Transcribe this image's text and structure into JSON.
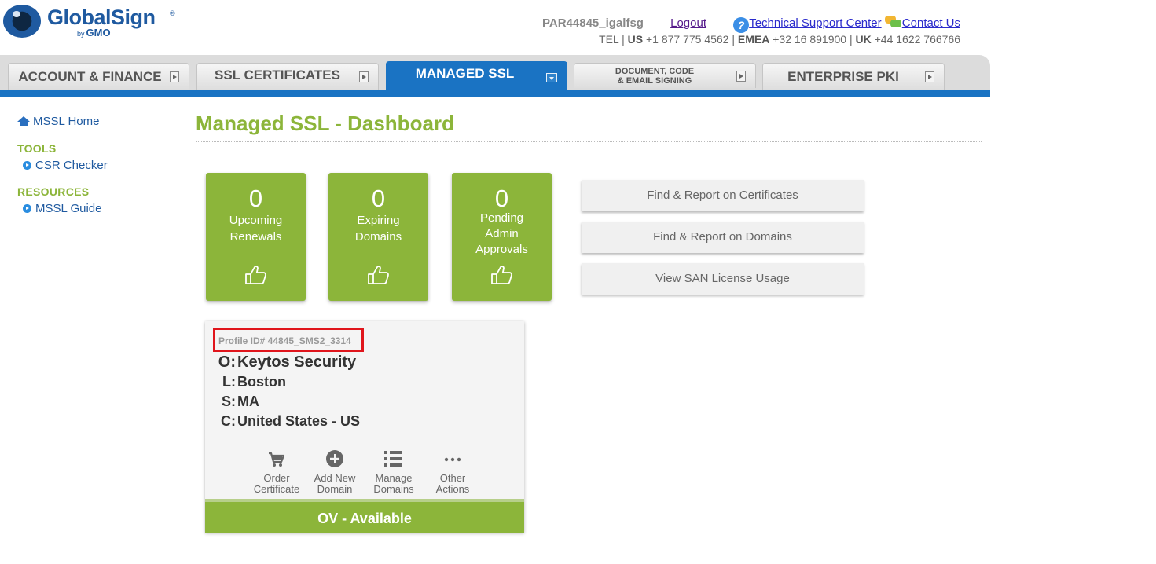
{
  "brand": {
    "name": "GlobalSign",
    "reg": "®",
    "by": "by",
    "gmo": "GMO"
  },
  "header": {
    "username": "PAR44845_igalfsg",
    "logout": "Logout",
    "support": "Technical Support Center",
    "contact": "Contact Us",
    "tel_label": "TEL",
    "us_label": "US",
    "us_phone": "+1 877 775 4562",
    "emea_label": "EMEA",
    "emea_phone": "+32 16 891900",
    "uk_label": "UK",
    "uk_phone": "+44 1622 766766",
    "sep": "|"
  },
  "nav": {
    "tabs": [
      {
        "label": "ACCOUNT & FINANCE"
      },
      {
        "label": "SSL CERTIFICATES"
      },
      {
        "label": "MANAGED SSL"
      },
      {
        "label_line1": "DOCUMENT, CODE",
        "label_line2": "& EMAIL SIGNING"
      },
      {
        "label": "ENTERPRISE PKI"
      }
    ]
  },
  "sidebar": {
    "home": "MSSL Home",
    "tools_heading": "TOOLS",
    "csr_checker": "CSR Checker",
    "resources_heading": "RESOURCES",
    "mssl_guide": "MSSL Guide"
  },
  "main": {
    "title": "Managed SSL - Dashboard",
    "stats": [
      {
        "value": "0",
        "line1": "Upcoming",
        "line2": "Renewals"
      },
      {
        "value": "0",
        "line1": "Expiring",
        "line2": "Domains"
      },
      {
        "value": "0",
        "line1": "Pending",
        "line2": "Admin",
        "line3": "Approvals"
      }
    ],
    "actions": [
      "Find & Report on Certificates",
      "Find & Report on Domains",
      "View SAN License Usage"
    ]
  },
  "profile": {
    "id": "Profile ID# 44845_SMS2_3314",
    "o_key": "O:",
    "o_value": "Keytos Security",
    "l_key": "L:",
    "l_value": "Boston",
    "s_key": "S:",
    "s_value": "MA",
    "c_key": "C:",
    "c_value": "United States - US",
    "actions": [
      {
        "line1": "Order",
        "line2": "Certificate"
      },
      {
        "line1": "Add New",
        "line2": "Domain"
      },
      {
        "line1": "Manage",
        "line2": "Domains"
      },
      {
        "line1": "Other",
        "line2": "Actions"
      }
    ],
    "status": "OV - Available"
  },
  "colors": {
    "brand_green": "#8cb53a",
    "brand_blue": "#1a73c3",
    "highlight_red": "#e0151c"
  },
  "icons": [
    "eye-logo-icon",
    "help-icon",
    "chat-icon",
    "arrow-icon",
    "home-icon",
    "bullet-icon",
    "thumbs-up-icon",
    "cart-icon",
    "plus-circle-icon",
    "list-icon",
    "more-icon"
  ]
}
